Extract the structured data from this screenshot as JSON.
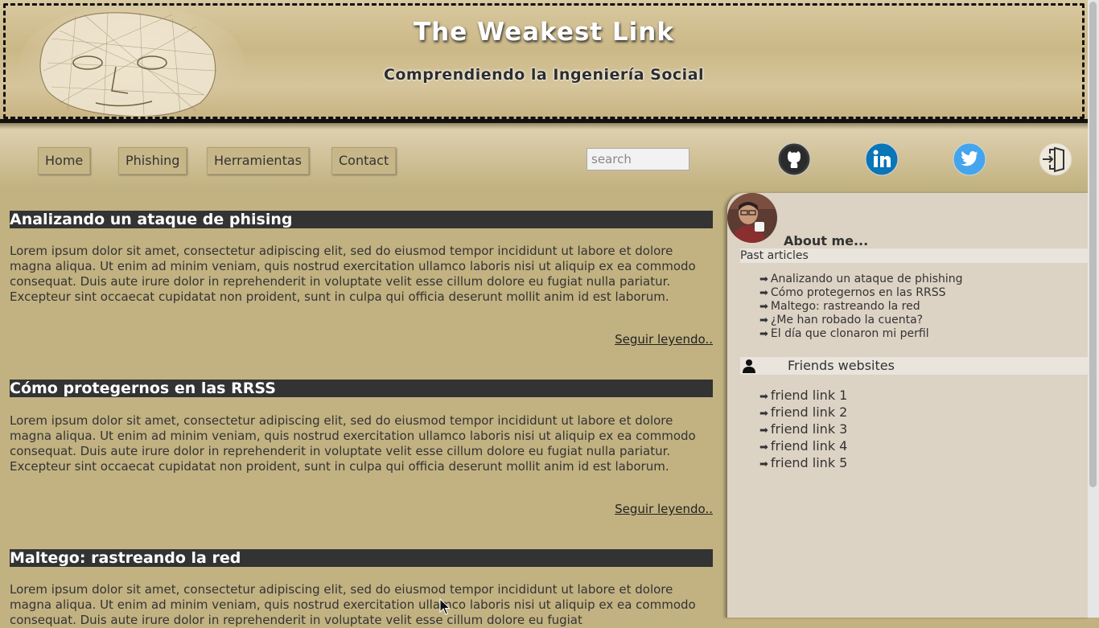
{
  "header": {
    "title": "The Weakest Link",
    "subtitle": "Comprendiendo la Ingeniería Social"
  },
  "nav": {
    "items": [
      {
        "label": "Home"
      },
      {
        "label": "Phishing"
      },
      {
        "label": "Herramientas"
      },
      {
        "label": "Contact"
      }
    ],
    "search_placeholder": "search",
    "social_icons": [
      "github-icon",
      "linkedin-icon",
      "twitter-icon",
      "login-icon"
    ]
  },
  "articles": [
    {
      "title": "Analizando un ataque de phising",
      "body": "Lorem ipsum dolor sit amet, consectetur adipiscing elit, sed do eiusmod tempor incididunt ut labore et dolore magna aliqua. Ut enim ad minim veniam, quis nostrud exercitation ullamco laboris nisi ut aliquip ex ea commodo consequat. Duis aute irure dolor in reprehenderit in voluptate velit esse cillum dolore eu fugiat nulla pariatur. Excepteur sint occaecat cupidatat non proident, sunt in culpa qui officia deserunt mollit anim id est laborum.",
      "read_more": "Seguir leyendo.."
    },
    {
      "title": "Cómo protegernos en las RRSS",
      "body": "Lorem ipsum dolor sit amet, consectetur adipiscing elit, sed do eiusmod tempor incididunt ut labore et dolore magna aliqua. Ut enim ad minim veniam, quis nostrud exercitation ullamco laboris nisi ut aliquip ex ea commodo consequat. Duis aute irure dolor in reprehenderit in voluptate velit esse cillum dolore eu fugiat nulla pariatur. Excepteur sint occaecat cupidatat non proident, sunt in culpa qui officia deserunt mollit anim id est laborum.",
      "read_more": "Seguir leyendo.."
    },
    {
      "title": "Maltego: rastreando la red",
      "body": "Lorem ipsum dolor sit amet, consectetur adipiscing elit, sed do eiusmod tempor incididunt ut labore et dolore magna aliqua. Ut enim ad minim veniam, quis nostrud exercitation ullamco laboris nisi ut aliquip ex ea commodo consequat. Duis aute irure dolor in reprehenderit in voluptate velit esse cillum dolore eu fugiat"
    }
  ],
  "sidebar": {
    "about": "About me...",
    "past_header": "Past articles",
    "past_articles": [
      "Analizando un ataque de phishing",
      "Cómo protegernos en las RRSS",
      "Maltego: rastreando la red",
      "¿Me han robado la cuenta?",
      "El día que clonaron mi perfil"
    ],
    "friends_header": "Friends websites",
    "friend_links": [
      "friend link 1",
      "friend link 2",
      "friend link 3",
      "friend link 4",
      "friend link 5"
    ],
    "arrow": "➡"
  },
  "colors": {
    "page_background": "#c2b281",
    "article_title_bar": "#333333",
    "sidebar_background": "#ddd3c5"
  }
}
